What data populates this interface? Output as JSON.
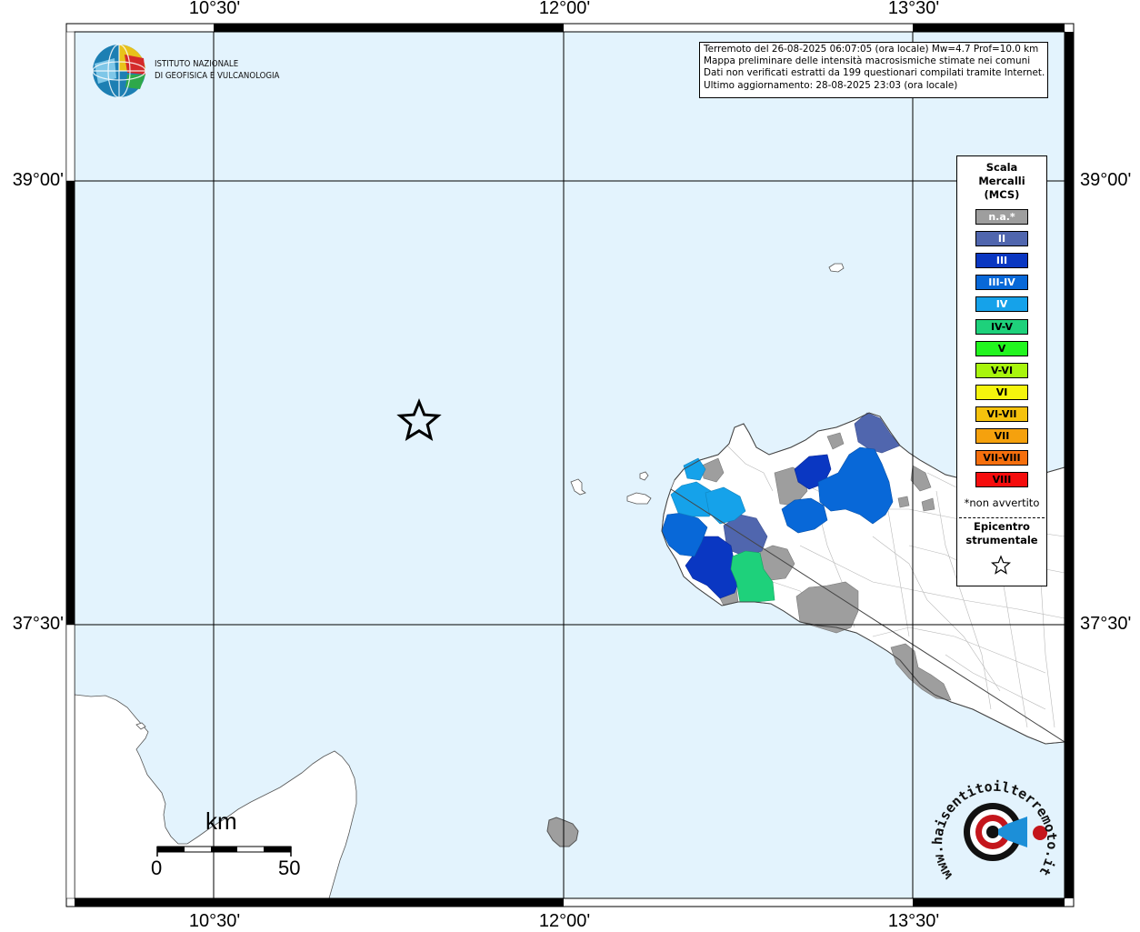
{
  "graticule": {
    "top_labels": [
      "10°30'",
      "12°00'",
      "13°30'"
    ],
    "bottom_labels": [
      "10°30'",
      "12°00'",
      "13°30'"
    ],
    "left_labels": [
      "39°00'",
      "37°30'"
    ],
    "right_labels": [
      "39°00'",
      "37°30'"
    ]
  },
  "logo": {
    "line1": "ISTITUTO NAZIONALE",
    "line2": "DI GEOFISICA E VULCANOLOGIA"
  },
  "info": {
    "line1": "Terremoto del 26-08-2025 06:07:05 (ora locale) Mw=4.7 Prof=10.0 km",
    "line2": "Mappa preliminare delle intensità macrosismiche stimate nei comuni",
    "line3": "Dati non verificati estratti da 199 questionari compilati tramite Internet.",
    "line4": "Ultimo aggiornamento: 28-08-2025 23:03 (ora locale)"
  },
  "legend": {
    "title_line1": "Scala",
    "title_line2": "Mercalli",
    "title_line3": "(MCS)",
    "items": [
      {
        "label": "n.a.*",
        "color": "#9e9e9e",
        "text_color": "#ffffff"
      },
      {
        "label": "II",
        "color": "#5066ae",
        "text_color": "#ffffff"
      },
      {
        "label": "III",
        "color": "#0a37c2",
        "text_color": "#ffffff"
      },
      {
        "label": "III-IV",
        "color": "#0868d8",
        "text_color": "#ffffff"
      },
      {
        "label": "IV",
        "color": "#15a2ea",
        "text_color": "#ffffff"
      },
      {
        "label": "IV-V",
        "color": "#1ed17b",
        "text_color": "#000000"
      },
      {
        "label": "V",
        "color": "#22f51f",
        "text_color": "#000000"
      },
      {
        "label": "V-VI",
        "color": "#a8f50d",
        "text_color": "#000000"
      },
      {
        "label": "VI",
        "color": "#f5f50d",
        "text_color": "#000000"
      },
      {
        "label": "VI-VII",
        "color": "#f5c20d",
        "text_color": "#000000"
      },
      {
        "label": "VII",
        "color": "#f5a10d",
        "text_color": "#000000"
      },
      {
        "label": "VII-VIII",
        "color": "#f56f0d",
        "text_color": "#000000"
      },
      {
        "label": "VIII",
        "color": "#f50d0d",
        "text_color": "#000000"
      }
    ],
    "note": "*non avvertito",
    "epicenter_line1": "Epicentro",
    "epicenter_line2": "strumentale"
  },
  "scale_bar": {
    "unit": "km",
    "start": "0",
    "end": "50"
  },
  "watermark": {
    "text": "www.haisentitoilterremoto.it"
  },
  "colors": {
    "sea": "#e3f3fd",
    "land": "#ffffff",
    "grid": "#000000"
  }
}
